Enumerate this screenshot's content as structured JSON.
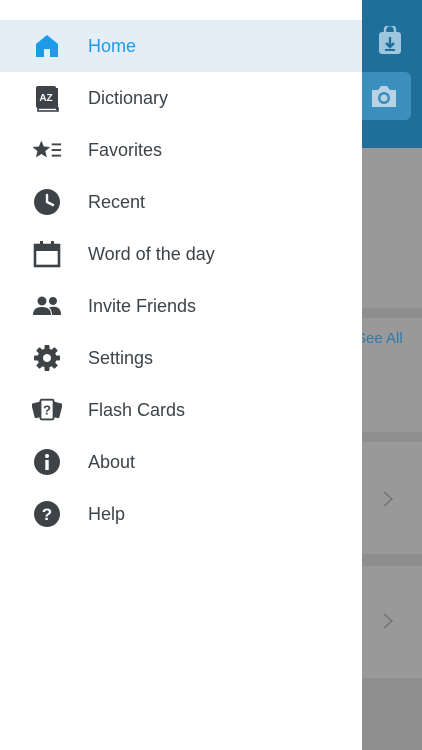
{
  "background": {
    "see_all_label": "See All",
    "icons": [
      "downloads-icon",
      "camera-icon",
      "chevron-right-icon"
    ],
    "colors": {
      "appbar": "#1f6f9a",
      "overlay": "#8e8e8e"
    }
  },
  "drawer": {
    "items": [
      {
        "label": "Home",
        "icon": "home-icon",
        "active": true
      },
      {
        "label": "Dictionary",
        "icon": "dictionary-icon"
      },
      {
        "label": "Favorites",
        "icon": "favorites-icon"
      },
      {
        "label": "Recent",
        "icon": "clock-icon"
      },
      {
        "label": "Word of the day",
        "icon": "calendar-icon"
      },
      {
        "label": "Invite Friends",
        "icon": "people-icon"
      },
      {
        "label": "Settings",
        "icon": "gear-icon"
      },
      {
        "label": "Flash Cards",
        "icon": "flash-cards-icon"
      },
      {
        "label": "About",
        "icon": "info-icon"
      },
      {
        "label": "Help",
        "icon": "help-icon"
      }
    ],
    "colors": {
      "active_bg": "#e3eef7",
      "active_text": "#1e9be8",
      "text": "#3d4347",
      "icon": "#3d4347"
    }
  }
}
